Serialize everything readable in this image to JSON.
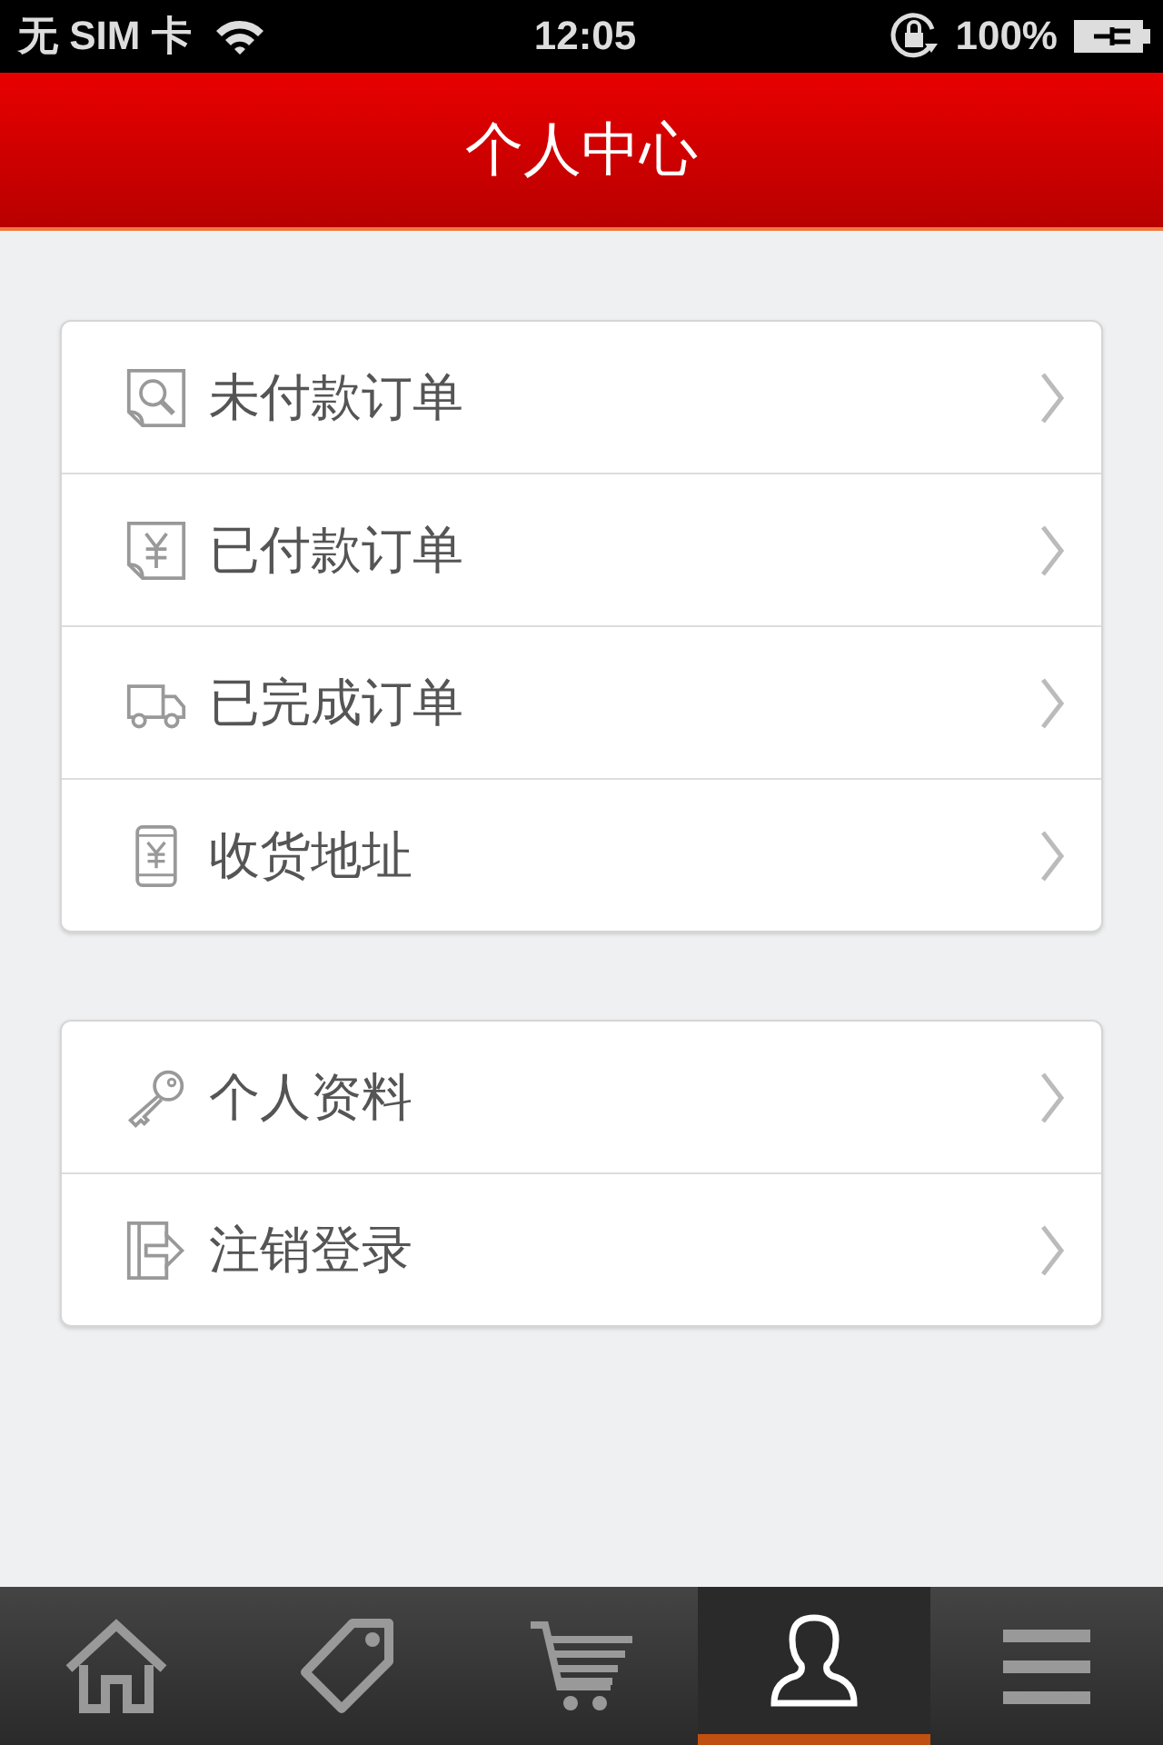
{
  "status_bar": {
    "carrier": "无 SIM 卡",
    "time": "12:05",
    "battery": "100%"
  },
  "header": {
    "title": "个人中心"
  },
  "groups": [
    {
      "items": [
        {
          "kind": "search-doc",
          "label": "未付款订单"
        },
        {
          "kind": "yen-doc",
          "label": "已付款订单"
        },
        {
          "kind": "truck",
          "label": "已完成订单"
        },
        {
          "kind": "phone",
          "label": "收货地址"
        }
      ]
    },
    {
      "items": [
        {
          "kind": "key",
          "label": "个人资料"
        },
        {
          "kind": "exit",
          "label": "注销登录"
        }
      ]
    }
  ],
  "tab_bar": [
    {
      "kind": "home",
      "selected": false
    },
    {
      "kind": "tag",
      "selected": false
    },
    {
      "kind": "cart",
      "selected": false
    },
    {
      "kind": "user",
      "selected": true
    },
    {
      "kind": "menu",
      "selected": false
    }
  ]
}
